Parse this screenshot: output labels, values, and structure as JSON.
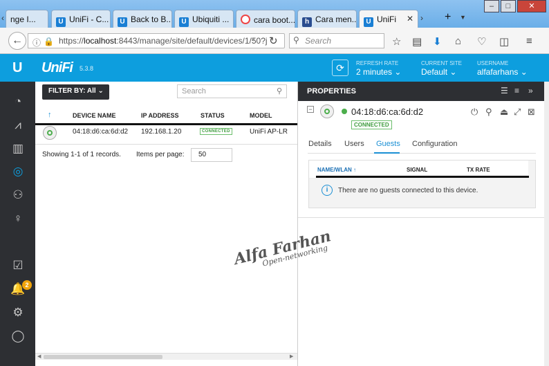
{
  "browser": {
    "tabs": [
      {
        "label": "nge I...",
        "icon": "arrow-icon"
      },
      {
        "label": "UniFi - C...",
        "icon": "unifi-icon"
      },
      {
        "label": "Back to B...",
        "icon": "unifi-icon"
      },
      {
        "label": "Ubiquiti ...",
        "icon": "unifi-icon"
      },
      {
        "label": "cara boot...",
        "icon": "google-icon"
      },
      {
        "label": "Cara men...",
        "icon": "h-icon"
      },
      {
        "label": "UniFi",
        "icon": "unifi-icon",
        "active": true
      }
    ],
    "new_tab": "+",
    "url_host": "localhost",
    "url_prefix": "https://",
    "url_rest": ":8443/manage/site/default/devices/1/50?j",
    "search_placeholder": "Search"
  },
  "header": {
    "logo_text": "UniFi",
    "version": "5.3.8",
    "refresh_label": "REFRESH RATE",
    "refresh_value": "2 minutes",
    "site_label": "CURRENT SITE",
    "site_value": "Default",
    "user_label": "USERNAME",
    "user_value": "alfafarhans"
  },
  "sidebar": {
    "items": [
      "dashboard-icon",
      "statistics-icon",
      "map-icon",
      "devices-icon",
      "clients-icon",
      "insights-icon",
      "tasks-icon",
      "alerts-icon",
      "settings-icon",
      "chat-icon"
    ],
    "alert_count": "2"
  },
  "devices": {
    "filter_label": "FILTER BY: All",
    "search_placeholder": "Search",
    "columns": [
      "DEVICE NAME",
      "IP ADDRESS",
      "STATUS",
      "MODEL"
    ],
    "rows": [
      {
        "name": "04:18:d6:ca:6d:d2",
        "ip": "192.168.1.20",
        "status": "CONNECTED",
        "model": "UniFi AP-LR"
      }
    ],
    "records_text": "Showing 1-1 of 1 records.",
    "per_page_label": "Items per page:",
    "per_page_value": "50"
  },
  "properties": {
    "title": "PROPERTIES",
    "device_mac": "04:18:d6:ca:6d:d2",
    "status": "CONNECTED",
    "tabs": [
      "Details",
      "Users",
      "Guests",
      "Configuration"
    ],
    "active_tab": "Guests",
    "guest_columns": [
      "NAME/WLAN",
      "SIGNAL",
      "TX RATE"
    ],
    "empty_message": "There are no guests connected to this device."
  },
  "watermark": {
    "line1": "Alfa Farhan",
    "line2": "Open-networking"
  },
  "colors": {
    "accent": "#0d9ede",
    "sidebar": "#2d2f33",
    "success": "#4cae4c",
    "badge": "#f0a30a"
  }
}
